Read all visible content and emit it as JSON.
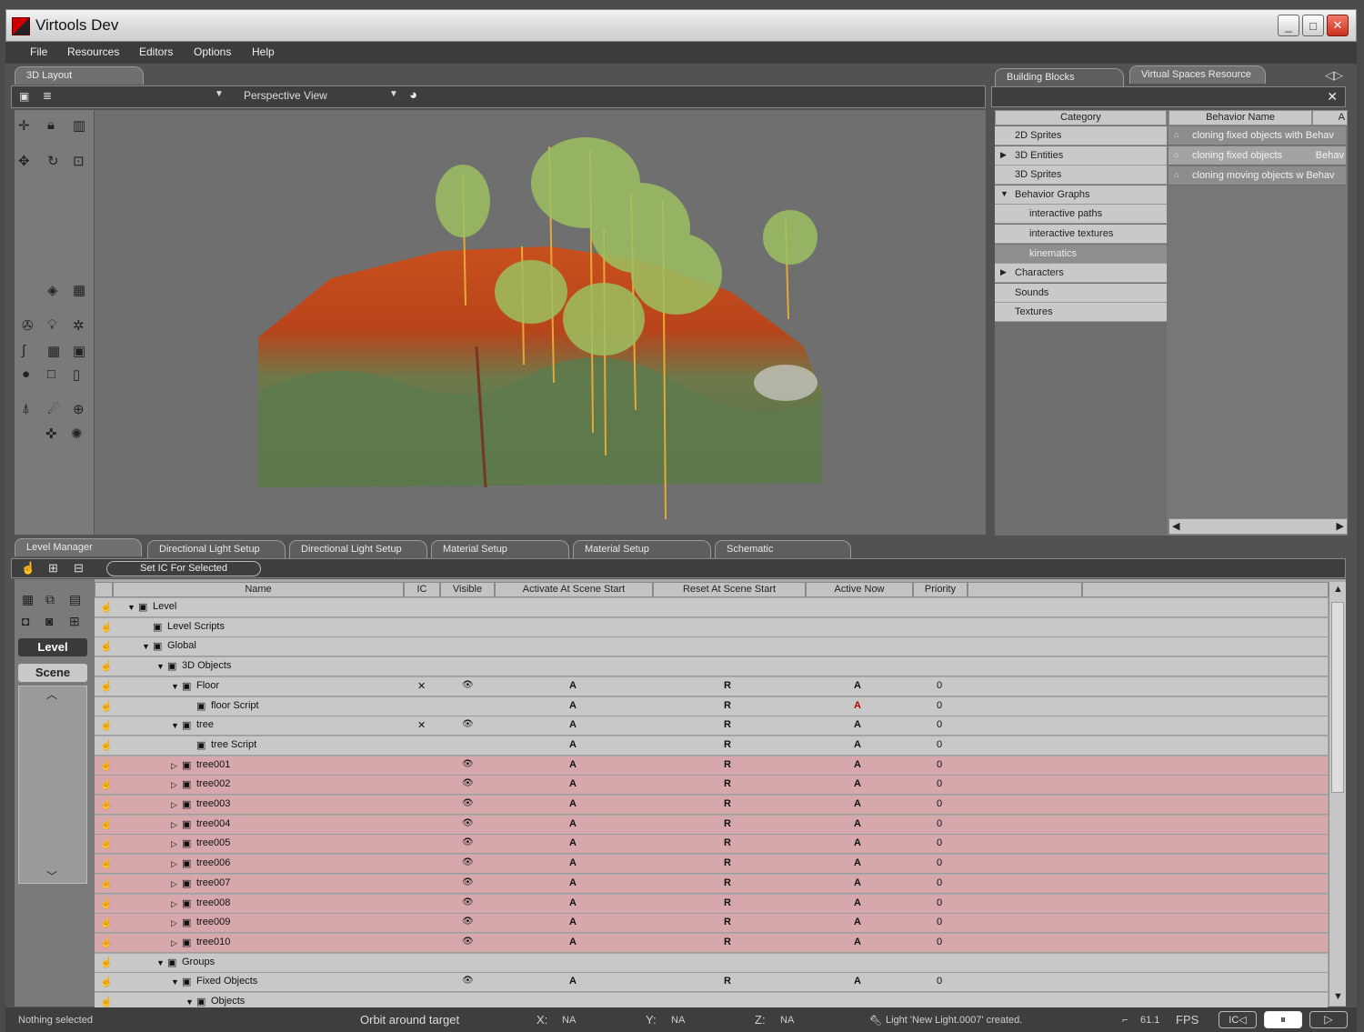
{
  "window": {
    "title": "Virtools Dev"
  },
  "menu": [
    "File",
    "Resources",
    "Editors",
    "Options",
    "Help"
  ],
  "layout_tab": "3D Layout",
  "view_select": "Perspective View",
  "right_tabs": [
    "Building Blocks",
    "Virtual Spaces Resource"
  ],
  "bb": {
    "category_header": "Category",
    "behavior_header": "Behavior Name",
    "behavior_header2": "A",
    "categories": [
      {
        "label": "2D Sprites",
        "arrow": ""
      },
      {
        "label": "3D Entities",
        "arrow": "▶"
      },
      {
        "label": "3D Sprites",
        "arrow": ""
      },
      {
        "label": "Behavior Graphs",
        "arrow": "▼"
      },
      {
        "label": "interactive paths",
        "arrow": ""
      },
      {
        "label": "interactive textures",
        "arrow": ""
      },
      {
        "label": "kinematics",
        "arrow": ""
      },
      {
        "label": "Characters",
        "arrow": "▶"
      },
      {
        "label": "Sounds",
        "arrow": ""
      },
      {
        "label": "Textures",
        "arrow": ""
      }
    ],
    "behaviors": [
      "cloning fixed objects with Behav",
      "cloning fixed objects",
      "cloning moving objects w Behav"
    ],
    "behaviors_b": [
      "",
      "Behav",
      ""
    ]
  },
  "bottom_tabs": [
    "Level Manager",
    "Directional Light Setup",
    "Directional Light Setup",
    "Material Setup",
    "Material Setup",
    "Schematic"
  ],
  "lm": {
    "set_ic": "Set IC For Selected",
    "side_level": "Level",
    "side_scene": "Scene",
    "headers": [
      "Name",
      "IC",
      "Visible",
      "Activate At Scene Start",
      "Reset At Scene Start",
      "Active Now",
      "Priority"
    ],
    "rows": [
      {
        "name": "Level",
        "arrow": "▼",
        "indent": 0,
        "color": "grey",
        "ic": "",
        "vis": "",
        "act": "",
        "reset": "",
        "now": "",
        "pri": ""
      },
      {
        "name": "Level Scripts",
        "arrow": "",
        "indent": 1,
        "color": "grey",
        "ic": "",
        "vis": "",
        "act": "",
        "reset": "",
        "now": "",
        "pri": ""
      },
      {
        "name": "Global",
        "arrow": "▼",
        "indent": 1,
        "color": "grey",
        "ic": "",
        "vis": "",
        "act": "",
        "reset": "",
        "now": "",
        "pri": ""
      },
      {
        "name": "3D Objects",
        "arrow": "▼",
        "indent": 2,
        "color": "grey",
        "ic": "",
        "vis": "",
        "act": "",
        "reset": "",
        "now": "",
        "pri": ""
      },
      {
        "name": "Floor",
        "arrow": "▼",
        "indent": 3,
        "color": "grey",
        "ic": "✕",
        "vis": "👁",
        "act": "A",
        "reset": "R",
        "now": "A",
        "pri": "0"
      },
      {
        "name": "floor Script",
        "arrow": "",
        "indent": 4,
        "color": "grey",
        "ic": "",
        "vis": "",
        "act": "A",
        "reset": "R",
        "now": "A",
        "pri": "0"
      },
      {
        "name": "tree",
        "arrow": "▼",
        "indent": 3,
        "color": "grey",
        "ic": "✕",
        "vis": "👁",
        "act": "A",
        "reset": "R",
        "now": "A",
        "pri": "0"
      },
      {
        "name": "tree Script",
        "arrow": "",
        "indent": 4,
        "color": "grey",
        "ic": "",
        "vis": "",
        "act": "A",
        "reset": "R",
        "now": "A",
        "pri": "0"
      },
      {
        "name": "tree001",
        "arrow": "▷",
        "indent": 3,
        "color": "pink",
        "ic": "",
        "vis": "👁",
        "act": "A",
        "reset": "R",
        "now": "A",
        "pri": "0"
      },
      {
        "name": "tree002",
        "arrow": "▷",
        "indent": 3,
        "color": "pink",
        "ic": "",
        "vis": "👁",
        "act": "A",
        "reset": "R",
        "now": "A",
        "pri": "0"
      },
      {
        "name": "tree003",
        "arrow": "▷",
        "indent": 3,
        "color": "pink",
        "ic": "",
        "vis": "👁",
        "act": "A",
        "reset": "R",
        "now": "A",
        "pri": "0"
      },
      {
        "name": "tree004",
        "arrow": "▷",
        "indent": 3,
        "color": "pink",
        "ic": "",
        "vis": "👁",
        "act": "A",
        "reset": "R",
        "now": "A",
        "pri": "0"
      },
      {
        "name": "tree005",
        "arrow": "▷",
        "indent": 3,
        "color": "pink",
        "ic": "",
        "vis": "👁",
        "act": "A",
        "reset": "R",
        "now": "A",
        "pri": "0"
      },
      {
        "name": "tree006",
        "arrow": "▷",
        "indent": 3,
        "color": "pink",
        "ic": "",
        "vis": "👁",
        "act": "A",
        "reset": "R",
        "now": "A",
        "pri": "0"
      },
      {
        "name": "tree007",
        "arrow": "▷",
        "indent": 3,
        "color": "pink",
        "ic": "",
        "vis": "👁",
        "act": "A",
        "reset": "R",
        "now": "A",
        "pri": "0"
      },
      {
        "name": "tree008",
        "arrow": "▷",
        "indent": 3,
        "color": "pink",
        "ic": "",
        "vis": "👁",
        "act": "A",
        "reset": "R",
        "now": "A",
        "pri": "0"
      },
      {
        "name": "tree009",
        "arrow": "▷",
        "indent": 3,
        "color": "pink",
        "ic": "",
        "vis": "👁",
        "act": "A",
        "reset": "R",
        "now": "A",
        "pri": "0"
      },
      {
        "name": "tree010",
        "arrow": "▷",
        "indent": 3,
        "color": "pink",
        "ic": "",
        "vis": "👁",
        "act": "A",
        "reset": "R",
        "now": "A",
        "pri": "0"
      },
      {
        "name": "Groups",
        "arrow": "▼",
        "indent": 2,
        "color": "grey",
        "ic": "",
        "vis": "",
        "act": "",
        "reset": "",
        "now": "",
        "pri": ""
      },
      {
        "name": "Fixed Objects",
        "arrow": "▼",
        "indent": 3,
        "color": "grey",
        "ic": "",
        "vis": "👁",
        "act": "A",
        "reset": "R",
        "now": "A",
        "pri": "0"
      },
      {
        "name": "Objects",
        "arrow": "▼",
        "indent": 4,
        "color": "grey",
        "ic": "",
        "vis": "",
        "act": "",
        "reset": "",
        "now": "",
        "pri": ""
      }
    ]
  },
  "status": {
    "selection": "Nothing selected",
    "mode": "Orbit around target",
    "x_label": "X:",
    "x_val": "NA",
    "y_label": "Y:",
    "y_val": "NA",
    "z_label": "Z:",
    "z_val": "NA",
    "message": "Light 'New Light.0007' created.",
    "fps_val": "61.1",
    "fps_label": "FPS"
  },
  "colors": {
    "pink_row": "#d6a8ab",
    "grey_row": "#c8c8c8",
    "terrain_orange": "#c8501e",
    "terrain_green": "#5e7a4c"
  }
}
